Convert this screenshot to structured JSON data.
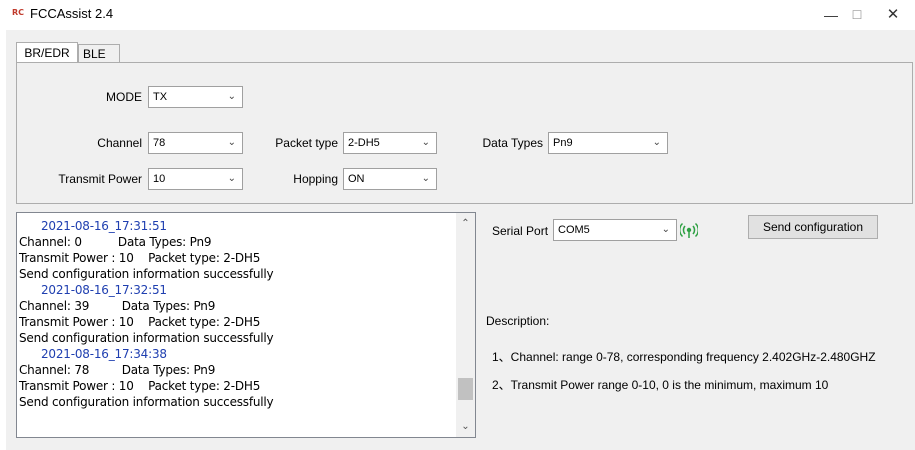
{
  "window": {
    "logo": "RC",
    "title": "FCCAssist 2.4",
    "minimize": "—",
    "maximize": "☐",
    "close": "✕"
  },
  "tabs": [
    {
      "label": "BR/EDR",
      "active": true
    },
    {
      "label": "BLE",
      "active": false
    }
  ],
  "form": {
    "mode": {
      "label": "MODE",
      "value": "TX"
    },
    "channel": {
      "label": "Channel",
      "value": "78"
    },
    "transmit_power": {
      "label": "Transmit Power",
      "value": "10"
    },
    "packet_type": {
      "label": "Packet type",
      "value": "2-DH5"
    },
    "hopping": {
      "label": "Hopping",
      "value": "ON"
    },
    "data_types": {
      "label": "Data Types",
      "value": "Pn9"
    }
  },
  "log": [
    {
      "type": "timestamp",
      "text": "2021-08-16_17:31:51"
    },
    {
      "type": "line",
      "text": "Channel: 0          Data Types: Pn9"
    },
    {
      "type": "line",
      "text": "Transmit Power : 10    Packet type: 2-DH5"
    },
    {
      "type": "line",
      "text": "Send configuration information successfully"
    },
    {
      "type": "timestamp",
      "text": "2021-08-16_17:32:51"
    },
    {
      "type": "line",
      "text": "Channel: 39         Data Types: Pn9"
    },
    {
      "type": "line",
      "text": "Transmit Power : 10    Packet type: 2-DH5"
    },
    {
      "type": "line",
      "text": "Send configuration information successfully"
    },
    {
      "type": "timestamp",
      "text": "2021-08-16_17:34:38"
    },
    {
      "type": "line",
      "text": "Channel: 78         Data Types: Pn9"
    },
    {
      "type": "line",
      "text": "Transmit Power : 10    Packet type: 2-DH5"
    },
    {
      "type": "line",
      "text": "Send configuration information successfully"
    }
  ],
  "scroll": {
    "up": "⌃",
    "down": "⌄",
    "position": 0.9
  },
  "serial": {
    "label": "Serial Port",
    "value": "COM5",
    "status_icon": "connected-signal-icon",
    "status_color": "#2ea043"
  },
  "send_button": "Send configuration",
  "description": {
    "heading": "Description:",
    "items": [
      "1、Channel: range 0-78, corresponding frequency 2.402GHz-2.480GHZ",
      "2、Transmit Power  range 0-10, 0 is the minimum, maximum 10"
    ]
  },
  "chevron": "⌄"
}
